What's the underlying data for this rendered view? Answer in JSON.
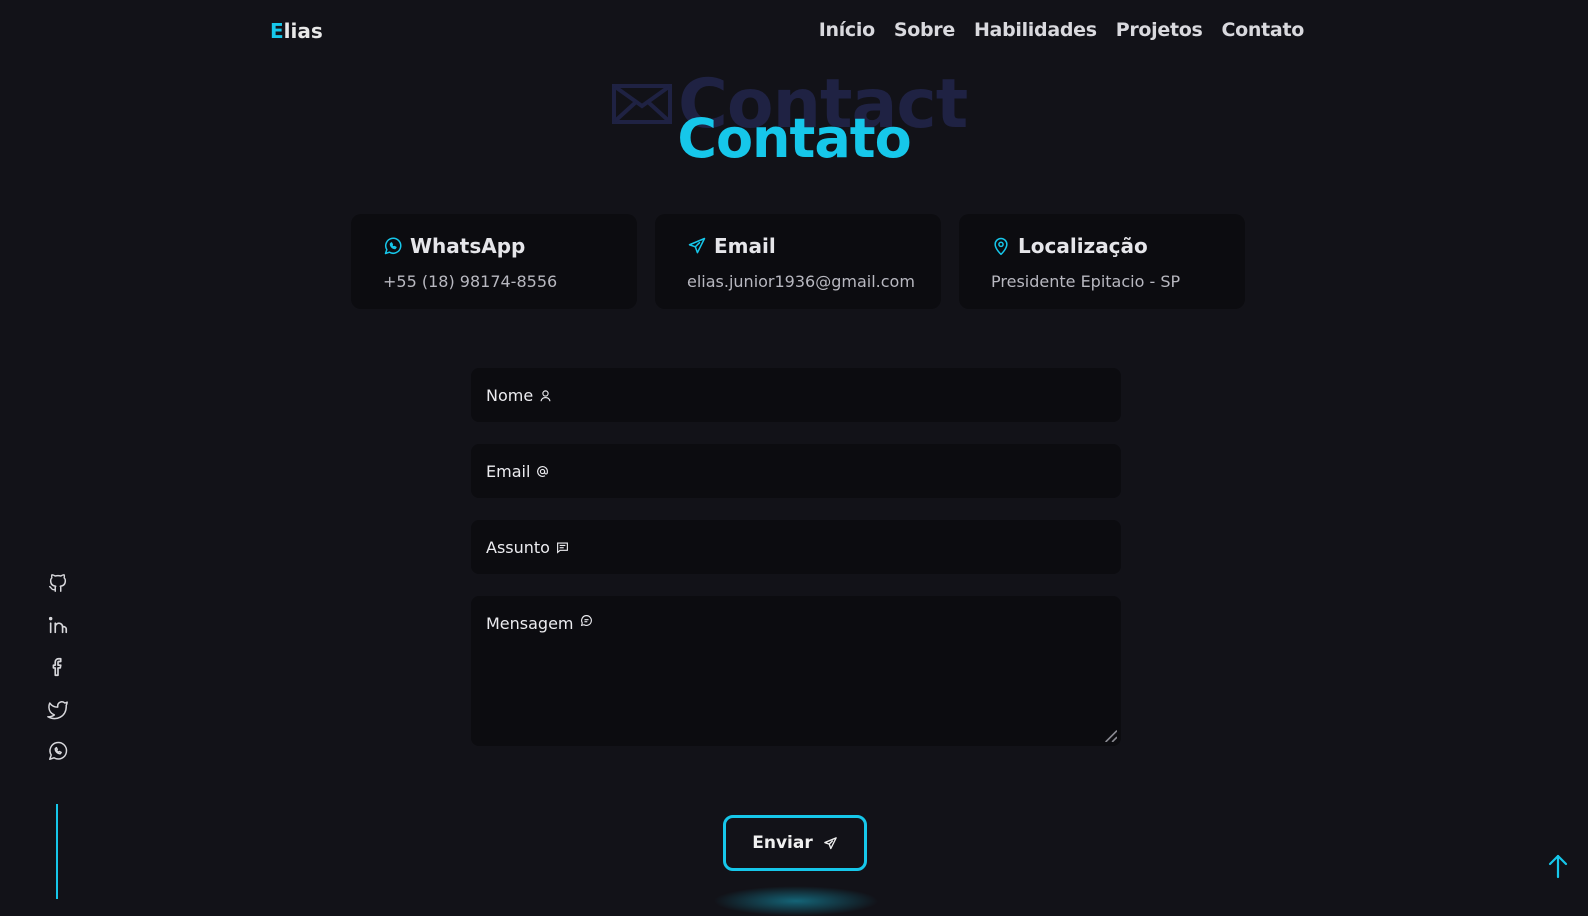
{
  "header": {
    "logo_initial": "E",
    "logo_rest": "lias",
    "nav": [
      {
        "label": "Início"
      },
      {
        "label": "Sobre"
      },
      {
        "label": "Habilidades"
      },
      {
        "label": "Projetos"
      },
      {
        "label": "Contato"
      }
    ]
  },
  "section": {
    "bg_title": "Contact",
    "title": "Contato"
  },
  "cards": [
    {
      "title": "WhatsApp",
      "text": "+55 (18) 98174-8556",
      "icon": "whatsapp-icon"
    },
    {
      "title": "Email",
      "text": "elias.junior1936@gmail.com",
      "icon": "paper-plane-icon"
    },
    {
      "title": "Localização",
      "text": "Presidente Epitacio - SP",
      "icon": "map-pin-icon"
    }
  ],
  "form": {
    "name_label": "Nome",
    "email_label": "Email",
    "subject_label": "Assunto",
    "message_label": "Mensagem",
    "submit_label": "Enviar"
  },
  "social": [
    "github-icon",
    "linkedin-icon",
    "facebook-icon",
    "twitter-icon",
    "whatsapp-icon"
  ],
  "colors": {
    "accent": "#16c7ea",
    "background": "#121218",
    "card": "#0c0c10"
  }
}
